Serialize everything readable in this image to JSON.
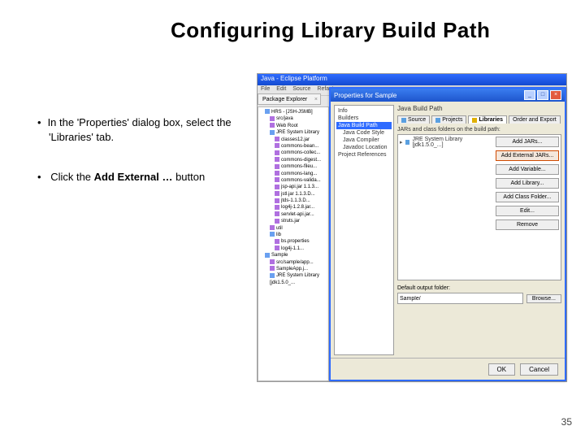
{
  "slide": {
    "title": "Configuring Library Build Path",
    "bullet1_pre": "In the 'Properties' dialog box, select the 'Libraries' tab.",
    "bullet2_pre": "Click the ",
    "bullet2_bold": "Add External …",
    "bullet2_post": " button",
    "page": "35"
  },
  "eclipse": {
    "title": "Java - Eclipse Platform",
    "menu": {
      "file": "File",
      "edit": "Edit",
      "source": "Source",
      "refactor": "Refactor"
    },
    "pkgTab": "Package Explorer",
    "tree": [
      {
        "lvl": "i1",
        "ico": "bico",
        "t": "HRS - [JSH-JSMB]"
      },
      {
        "lvl": "i2",
        "ico": "fico",
        "t": "src/java"
      },
      {
        "lvl": "i2",
        "ico": "fico",
        "t": "Web Root"
      },
      {
        "lvl": "i2",
        "ico": "bico",
        "t": "JRE System Library"
      },
      {
        "lvl": "i3",
        "ico": "fico",
        "t": "classes12.jar"
      },
      {
        "lvl": "i3",
        "ico": "fico",
        "t": "commons-bean..."
      },
      {
        "lvl": "i3",
        "ico": "fico",
        "t": "commons-collec..."
      },
      {
        "lvl": "i3",
        "ico": "fico",
        "t": "commons-digest..."
      },
      {
        "lvl": "i3",
        "ico": "fico",
        "t": "commons-fileu..."
      },
      {
        "lvl": "i3",
        "ico": "fico",
        "t": "commons-lang..."
      },
      {
        "lvl": "i3",
        "ico": "fico",
        "t": "commons-valida..."
      },
      {
        "lvl": "i3",
        "ico": "fico",
        "t": "jsp-api.jar 1.1.3..."
      },
      {
        "lvl": "i3",
        "ico": "fico",
        "t": "jstl.jar 1.1.3.D..."
      },
      {
        "lvl": "i3",
        "ico": "fico",
        "t": "jtds-1.1.3.D..."
      },
      {
        "lvl": "i3",
        "ico": "fico",
        "t": "log4j-1.2.8.jar..."
      },
      {
        "lvl": "i3",
        "ico": "fico",
        "t": "servlet-api.jar..."
      },
      {
        "lvl": "i3",
        "ico": "fico",
        "t": "struts.jar"
      },
      {
        "lvl": "i2",
        "ico": "fico",
        "t": "util"
      },
      {
        "lvl": "i2",
        "ico": "bico",
        "t": "lib"
      },
      {
        "lvl": "i3",
        "ico": "fico",
        "t": "bs.properties"
      },
      {
        "lvl": "i3",
        "ico": "fico",
        "t": "log4j-1.1..."
      },
      {
        "lvl": "i1",
        "ico": "bico",
        "t": "Sample"
      },
      {
        "lvl": "i2",
        "ico": "fico",
        "t": "src/sample/app..."
      },
      {
        "lvl": "i2",
        "ico": "fico",
        "t": "SampleApp.j..."
      },
      {
        "lvl": "i2",
        "ico": "bico",
        "t": "JRE System Library [jdk1.5.0_..."
      }
    ]
  },
  "dialog": {
    "title": "Properties for Sample",
    "left": {
      "info": "Info",
      "builders": "Builders",
      "buildpath": "Java Build Path",
      "codestyle": "Java Code Style",
      "compiler": "Java Compiler",
      "javadoc": "Javadoc Location",
      "refs": "Project References"
    },
    "header": "Java Build Path",
    "tabs": {
      "source": "Source",
      "projects": "Projects",
      "libraries": "Libraries",
      "order": "Order and Export"
    },
    "foldersLabel": "JARs and class folders on the build path:",
    "jarEntry": "JRE System Library [jdk1.5.0_...]",
    "buttons": {
      "addjars": "Add JARs...",
      "addext": "Add External JARs...",
      "addvar": "Add Variable...",
      "addlib": "Add Library...",
      "addfolder": "Add Class Folder...",
      "edit": "Edit...",
      "remove": "Remove"
    },
    "defaultLabel": "Default output folder:",
    "defaultValue": "Sample/",
    "browse": "Browse...",
    "ok": "OK",
    "cancel": "Cancel"
  }
}
